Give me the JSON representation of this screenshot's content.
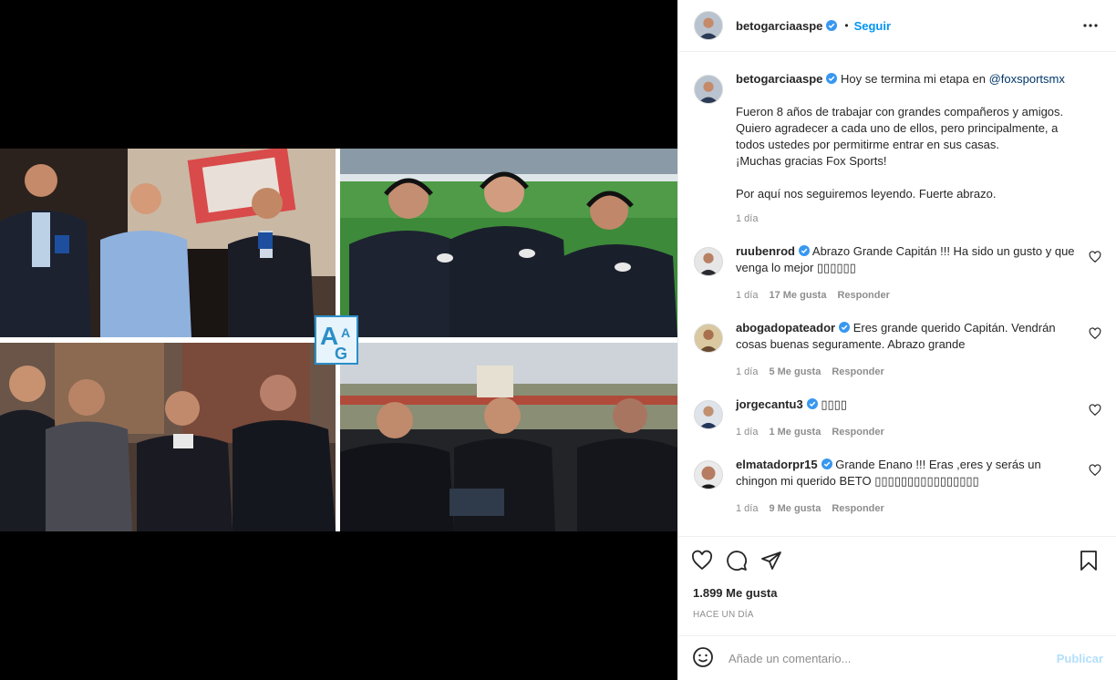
{
  "header": {
    "username": "betogarciaaspe",
    "separator": "•",
    "follow_label": "Seguir"
  },
  "caption": {
    "username": "betogarciaaspe",
    "text_before_mention": "Hoy se termina mi etapa en ",
    "mention": "@foxsportsmx",
    "paragraph_1_line_1": "Fueron 8 años de trabajar con grandes compañeros y amigos.",
    "paragraph_1_line_2": "Quiero agradecer a cada uno de ellos, pero principalmente, a todos ustedes por permitirme entrar en sus casas.",
    "paragraph_1_line_3": "¡Muchas gracias Fox Sports!",
    "paragraph_2": "Por aquí nos seguiremos leyendo. Fuerte abrazo.",
    "time": "1 día"
  },
  "comments": [
    {
      "username": "ruubenrod",
      "text": "Abrazo Grande Capitán !!! Ha sido un gusto y que venga lo mejor ▯▯▯▯▯▯",
      "time": "1 día",
      "likes": "17 Me gusta",
      "reply": "Responder"
    },
    {
      "username": "abogadopateador",
      "text": "Eres grande querido Capitán. Vendrán cosas buenas seguramente. Abrazo grande",
      "time": "1 día",
      "likes": "5 Me gusta",
      "reply": "Responder"
    },
    {
      "username": "jorgecantu3",
      "text": "▯▯▯▯",
      "time": "1 día",
      "likes": "1 Me gusta",
      "reply": "Responder"
    },
    {
      "username": "elmatadorpr15",
      "text": "Grande Enano !!! Eras ,eres y serás un chingon mi querido BETO ▯▯▯▯▯▯▯▯▯▯▯▯▯▯▯▯",
      "time": "1 día",
      "likes": "9 Me gusta",
      "reply": "Responder"
    }
  ],
  "actions": {
    "likes_count": "1.899 Me gusta",
    "time_ago": "HACE UN DÍA"
  },
  "comment_box": {
    "placeholder": "Añade un comentario...",
    "publish_label": "Publicar"
  },
  "colors": {
    "link_blue": "#0095f6",
    "mention": "#00376b",
    "muted": "#8e8e8e",
    "publish_disabled": "#b2dffc",
    "verified": "#3897f0"
  },
  "icons": {
    "verified": "verified-badge-icon",
    "more": "more-options-icon",
    "like": "heart-icon",
    "comment": "comment-bubble-icon",
    "share": "paper-plane-icon",
    "save": "bookmark-icon",
    "emoji": "emoji-smiley-icon"
  }
}
